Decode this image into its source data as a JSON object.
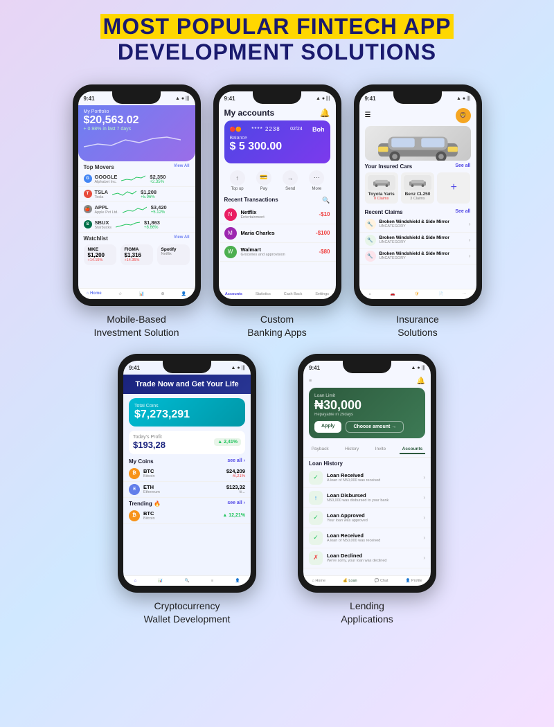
{
  "header": {
    "line1_part1": "MOST POPULAR FINTECH APP",
    "line2": "DEVELOPMENT SOLUTIONS"
  },
  "phones": {
    "investment": {
      "label": "Mobile-Based\nInvestment Solution",
      "time": "9:41",
      "portfolio_label": "My Portfolio",
      "amount": "$20,563.02",
      "change": "+ 0.98% in last 7 days",
      "movers_title": "Top Movers",
      "view_all": "View All",
      "stocks": [
        {
          "name": "GOOGLE",
          "sub": "Alphabet Inc.",
          "price": "$2,350",
          "pct": "+2.35%",
          "pos": true
        },
        {
          "name": "TSLA",
          "sub": "Tesla",
          "price": "$1,208",
          "pct": "+5.96%",
          "pos": true
        },
        {
          "name": "APPL",
          "sub": "Apple Pvt Ltd.",
          "price": "$3,420",
          "pct": "+5.12%",
          "pos": true
        },
        {
          "name": "SBUX",
          "sub": "Starbucks",
          "price": "$1,863",
          "pct": "+8.66%",
          "pos": true
        }
      ],
      "watchlist_title": "Watchlist",
      "watchlist": [
        {
          "name": "NIKE",
          "price": "$1,200",
          "pct": "+14.15%",
          "pos": true
        },
        {
          "name": "FIGMA",
          "price": "$1,316",
          "pct": "+14.35%",
          "pos": true
        }
      ],
      "bottom_nav": [
        "Home",
        "",
        "",
        "",
        ""
      ]
    },
    "banking": {
      "label": "Custom\nBanking Apps",
      "time": "9:41",
      "screen_title": "My accounts",
      "card_last4": "**** 2238",
      "card_exp": "02/24",
      "balance_label": "Balance",
      "balance": "$ 5 300.00",
      "actions": [
        "Top up",
        "Pay",
        "Send",
        "More"
      ],
      "transactions_title": "Recent Transactions",
      "transactions": [
        {
          "name": "Netflix",
          "sub": "Entertainment",
          "amount": "-$10",
          "color": "#e91e63"
        },
        {
          "name": "Maria Charles",
          "sub": "",
          "amount": "-$100",
          "color": "#9c27b0"
        },
        {
          "name": "Walmart",
          "sub": "Groceries and approvision",
          "amount": "-$80",
          "color": "#4caf50"
        }
      ],
      "bottom_nav": [
        "Accounts",
        "Statistics",
        "Cash Back",
        "Settings"
      ]
    },
    "insurance": {
      "label": "Insurance\nSolutions",
      "time": "9:41",
      "insured_cars_title": "Your Insured Cars",
      "cars": [
        {
          "name": "Toyota Yaris",
          "claims": "0 Claims"
        },
        {
          "name": "Benz CL250",
          "claims": "3 Claims"
        }
      ],
      "claims_title": "Recent Claims",
      "claims": [
        "Broken Windshield & Side Mirror",
        "Broken Windshield & Side Mirror",
        "Broken Windshield & Side Mirror"
      ],
      "bottom_nav": [
        "Home",
        "",
        "Insurance",
        "",
        ""
      ]
    },
    "crypto": {
      "label": "Cryptocurrency\nWallet Development",
      "time": "9:41",
      "trade_title": "Trade Now and Get Your Life",
      "total_coins_label": "Total Coins",
      "total_coins": "$7,273,291",
      "profit_label": "Today's Profit",
      "profit": "$193,28",
      "profit_pct": "▲ 2,41%",
      "my_coins_title": "My Coins",
      "coins": [
        {
          "name": "BTC",
          "sub": "Bitcoin",
          "price": "$24,209",
          "change": "-6,21%"
        },
        {
          "name": "ETH",
          "sub": "Ethereum",
          "price": "$123,32",
          "change": ""
        }
      ],
      "trending_title": "Trending 🔥",
      "trending": [
        {
          "name": "BTC",
          "sub": "Bitcoin",
          "change": "▲ 12,21%",
          "pos": true
        }
      ],
      "bottom_nav": [
        "",
        "",
        "",
        "",
        ""
      ]
    },
    "lending": {
      "label": "Lending\nApplications",
      "time": "9:41",
      "loan_limit_sub": "Loan Limit",
      "loan_amount": "30,000",
      "loan_info": "Repayable in 29days",
      "apply_btn": "Apply",
      "choose_btn": "Choose amount →",
      "tabs": [
        "Payback",
        "History",
        "Invite",
        "Accounts"
      ],
      "loan_history_title": "Loan History",
      "history": [
        {
          "name": "Loan Received",
          "sub": "A loan of N50,000 was received",
          "icon": "✓"
        },
        {
          "name": "Loan Disbursed",
          "sub": "N50,000 was disbursed to your bank",
          "icon": "↑"
        },
        {
          "name": "Loan Approved",
          "sub": "Your loan was approved",
          "icon": "✓"
        },
        {
          "name": "Loan Received",
          "sub": "A loan of N50,000 was received",
          "icon": "✓"
        },
        {
          "name": "Loan Declined",
          "sub": "We're sorry, your loan was declined",
          "icon": "✗"
        }
      ],
      "bottom_nav": [
        "Home",
        "Loan",
        "Chat",
        "Profile"
      ]
    }
  }
}
